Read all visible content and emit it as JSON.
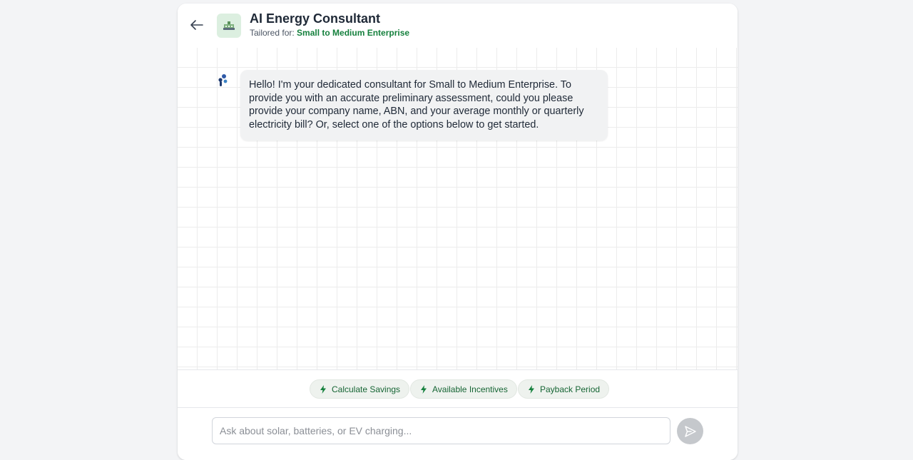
{
  "header": {
    "title": "AI Energy Consultant",
    "tailored_label": "Tailored for:",
    "segment": "Small to Medium Enterprise",
    "back_icon": "arrow-left-icon",
    "logo_icon": "office-building-icon"
  },
  "chat": {
    "messages": [
      {
        "role": "assistant",
        "avatar_icon": "bot-logo-icon",
        "text": "Hello! I'm your dedicated consultant for Small to Medium Enterprise. To provide you with an accurate preliminary assessment, could you please provide your company name, ABN, and your average monthly or quarterly electricity bill? Or, select one of the options below to get started."
      }
    ]
  },
  "quick_actions": [
    {
      "label": "Calculate Savings",
      "icon": "lightning-bolt-icon"
    },
    {
      "label": "Available Incentives",
      "icon": "lightning-bolt-icon"
    },
    {
      "label": "Payback Period",
      "icon": "lightning-bolt-icon"
    }
  ],
  "composer": {
    "placeholder": "Ask about solar, batteries, or EV charging...",
    "value": "",
    "send_icon": "send-icon"
  },
  "colors": {
    "accent_green": "#15803d",
    "chip_bg": "#eef2ee",
    "bubble_bg": "#f1f2f3",
    "send_disabled": "#c5c8cc"
  }
}
